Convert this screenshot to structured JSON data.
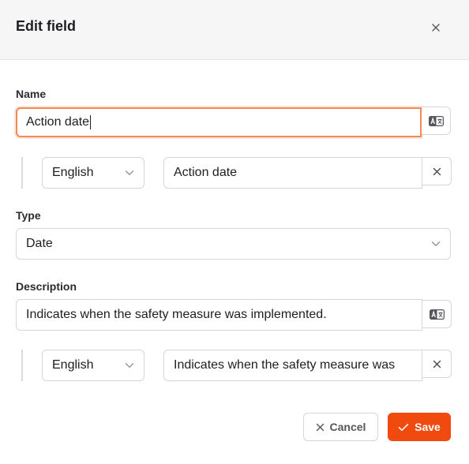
{
  "dialog": {
    "title": "Edit field",
    "close_icon": "close-icon"
  },
  "name_section": {
    "label": "Name",
    "value": "Action date",
    "translate_icon": "translate-icon",
    "translation": {
      "language": "English",
      "value": "Action date",
      "remove_icon": "close-icon"
    }
  },
  "type_section": {
    "label": "Type",
    "selected": "Date"
  },
  "description_section": {
    "label": "Description",
    "value": "Indicates when the safety measure was implemented.",
    "translate_icon": "translate-icon",
    "translation": {
      "language": "English",
      "value": "Indicates when the safety measure was",
      "remove_icon": "close-icon"
    }
  },
  "footer": {
    "cancel_label": "Cancel",
    "save_label": "Save"
  },
  "colors": {
    "accent": "#f04a0f",
    "focus_ring": "#f28a55",
    "header_bg": "#f6f6f7",
    "border": "#d6d6da"
  }
}
